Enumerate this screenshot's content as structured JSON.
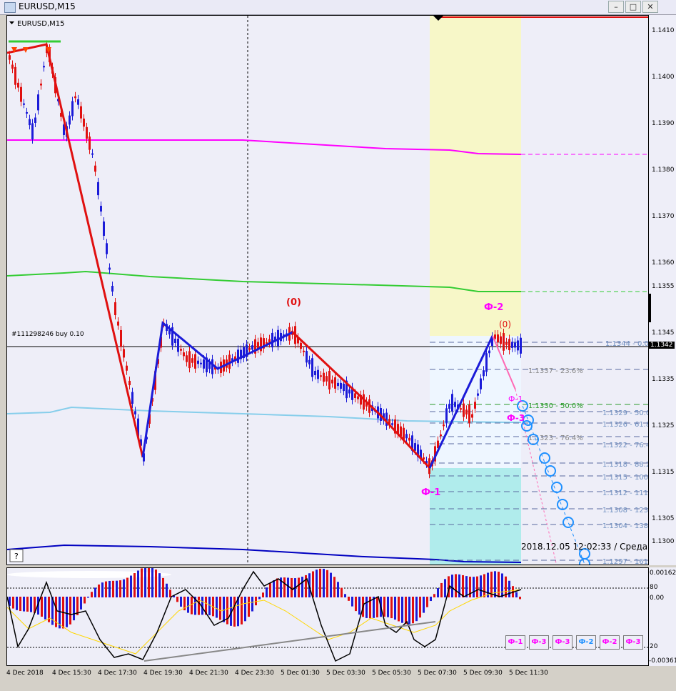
{
  "window": {
    "title": "EURUSD,M15"
  },
  "chart": {
    "symbol_label": "EURUSD,M15",
    "order_label": "#111298246 buy 0.10",
    "current_price": "1.1342",
    "timestamp": "2018.12.05 12:02:33 / Среда",
    "help_button": "?",
    "wave_labels": {
      "zero_main": "(0)",
      "zero_right": "(0)",
      "phi2": "Ф-2",
      "phi1": "Ф-1",
      "phi1_small": "Ф-1",
      "phi3": "Ф-3"
    },
    "price_axis": [
      "1.1410",
      "1.1400",
      "1.1390",
      "1.1380",
      "1.1370",
      "1.1360",
      "1.1355",
      "1.1345",
      "1.1342",
      "1.1335",
      "1.1325",
      "1.1315",
      "1.1305",
      "1.1300"
    ],
    "fib_levels": [
      "1.1344 - 0.0",
      "1.1337 - 23.6%",
      "1.1330 - 50.0%",
      "1.1329 - 50.0",
      "1.1326 - 61.8",
      "1.1323 - 76.4%",
      "1.1322 - 76.4",
      "1.1318 - 88.2",
      "1.1315 - 100.",
      "1.1312 - 111.",
      "1.1308 - 123.",
      "1.1304 - 138.",
      "1.1297 - 161."
    ],
    "colors": {
      "bull": "#1b1bd8",
      "bear": "#e01010",
      "magenta": "#ff00ff",
      "green": "#33cc33",
      "cyan": "#87ceeb",
      "navy": "#0000c0",
      "yellow_zone": "#f7f7c8",
      "cyan_zone": "#b0ecec",
      "blue_zone": "#eef6ff"
    }
  },
  "indicator": {
    "axis": [
      "0.00162",
      "80",
      "0.00",
      "20",
      "-0.00361"
    ],
    "buttons": [
      "Ф-1",
      "Ф-3",
      "Ф-3",
      "Ф-2",
      "Ф-2",
      "Ф-3"
    ],
    "button_colors": [
      "#ff00ff",
      "#ff00ff",
      "#ff00ff",
      "#1e90ff",
      "#ff00ff",
      "#ff00ff"
    ]
  },
  "time_axis": [
    "4 Dec 2018",
    "4 Dec 15:30",
    "4 Dec 17:30",
    "4 Dec 19:30",
    "4 Dec 21:30",
    "4 Dec 23:30",
    "5 Dec 01:30",
    "5 Dec 03:30",
    "5 Dec 05:30",
    "5 Dec 07:30",
    "5 Dec 09:30",
    "5 Dec 11:30"
  ]
}
